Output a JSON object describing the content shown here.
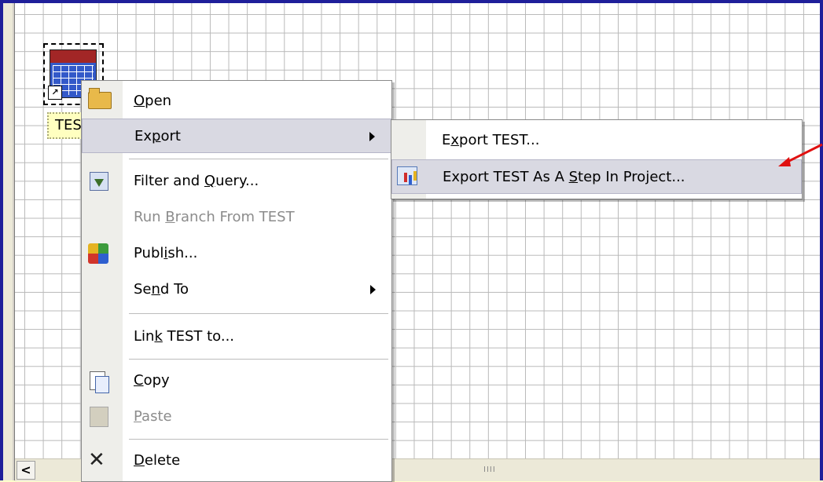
{
  "object": {
    "label": "TES"
  },
  "context_menu": {
    "items": [
      {
        "id": "open",
        "label_pre": "",
        "label_u": "O",
        "label_post": "pen",
        "icon": "open-folder-icon",
        "disabled": false,
        "submenu": false
      },
      {
        "id": "export",
        "label_pre": "Ex",
        "label_u": "p",
        "label_post": "ort",
        "icon": "",
        "disabled": false,
        "submenu": true,
        "highlighted": true
      },
      {
        "id": "filter",
        "label_pre": "Filter and ",
        "label_u": "Q",
        "label_post": "uery...",
        "icon": "filter-icon",
        "disabled": false,
        "submenu": false
      },
      {
        "id": "run",
        "label_pre": "Run ",
        "label_u": "B",
        "label_post": "ranch From TEST",
        "icon": "",
        "disabled": true,
        "submenu": false
      },
      {
        "id": "publish",
        "label_pre": "Publ",
        "label_u": "i",
        "label_post": "sh...",
        "icon": "publish-icon",
        "disabled": false,
        "submenu": false
      },
      {
        "id": "sendto",
        "label_pre": "Se",
        "label_u": "n",
        "label_post": "d To",
        "icon": "",
        "disabled": false,
        "submenu": true
      },
      {
        "id": "link",
        "label_pre": "Lin",
        "label_u": "k",
        "label_post": " TEST to...",
        "icon": "",
        "disabled": false,
        "submenu": false
      },
      {
        "id": "copy",
        "label_pre": "",
        "label_u": "C",
        "label_post": "opy",
        "icon": "copy-icon",
        "disabled": false,
        "submenu": false
      },
      {
        "id": "paste",
        "label_pre": "",
        "label_u": "P",
        "label_post": "aste",
        "icon": "paste-icon",
        "disabled": true,
        "submenu": false
      },
      {
        "id": "delete",
        "label_pre": "",
        "label_u": "D",
        "label_post": "elete",
        "icon": "delete-icon",
        "disabled": false,
        "submenu": false
      }
    ]
  },
  "export_submenu": {
    "items": [
      {
        "id": "export_test",
        "label_pre": "E",
        "label_u": "x",
        "label_post": "port TEST...",
        "icon": ""
      },
      {
        "id": "export_step",
        "label_pre": "Export TEST As A ",
        "label_u": "S",
        "label_post": "tep In Project...",
        "icon": "export-step-icon",
        "highlighted": true
      }
    ]
  },
  "scrollbar": {
    "left_arrow": "<",
    "grip": "IIII"
  },
  "colors": {
    "frame": "#1f1f9a",
    "menu_highlight": "#d9d9e2",
    "annotation_arrow": "#e01010"
  }
}
